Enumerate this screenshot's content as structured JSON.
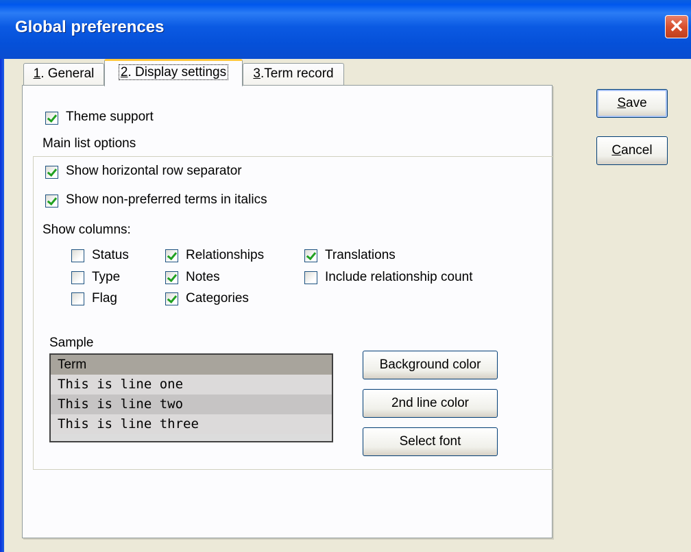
{
  "window": {
    "title": "Global preferences",
    "close_label": "✕"
  },
  "tabs": [
    {
      "num": "1",
      "rest": ". General",
      "active": false
    },
    {
      "num": "2",
      "rest": ". Display settings",
      "active": true
    },
    {
      "num": "3",
      "rest": ".Term record",
      "active": false
    }
  ],
  "display": {
    "theme_support": {
      "label": "Theme support",
      "checked": true
    },
    "main_list_options": "Main list options",
    "row_separator": {
      "label": "Show horizontal row separator",
      "checked": true
    },
    "italics": {
      "label": "Show non-preferred terms in italics",
      "checked": true
    },
    "show_columns": "Show columns:",
    "columns": [
      {
        "label": "Status",
        "checked": false
      },
      {
        "label": "Type",
        "checked": false
      },
      {
        "label": "Flag",
        "checked": false
      },
      {
        "label": "Relationships",
        "checked": true
      },
      {
        "label": "Notes",
        "checked": true
      },
      {
        "label": "Categories",
        "checked": true
      },
      {
        "label": "Translations",
        "checked": true
      },
      {
        "label": "Include relationship count",
        "checked": false
      }
    ],
    "sample": {
      "label": "Sample",
      "rows": [
        "Term",
        "This is line one",
        "This is line two",
        "This is line three"
      ]
    },
    "buttons": {
      "background_color": "Background color",
      "second_line_color": "2nd line color",
      "select_font": "Select font"
    }
  },
  "actions": {
    "save_mnemonic": "S",
    "save_rest": "ave",
    "cancel_mnemonic": "C",
    "cancel_rest": "ancel"
  },
  "colors": {
    "title_bar": "#0058ee",
    "dialog_bg": "#ece9d8",
    "checkmark": "#21a121",
    "tab_highlight": "#ffc83c"
  }
}
